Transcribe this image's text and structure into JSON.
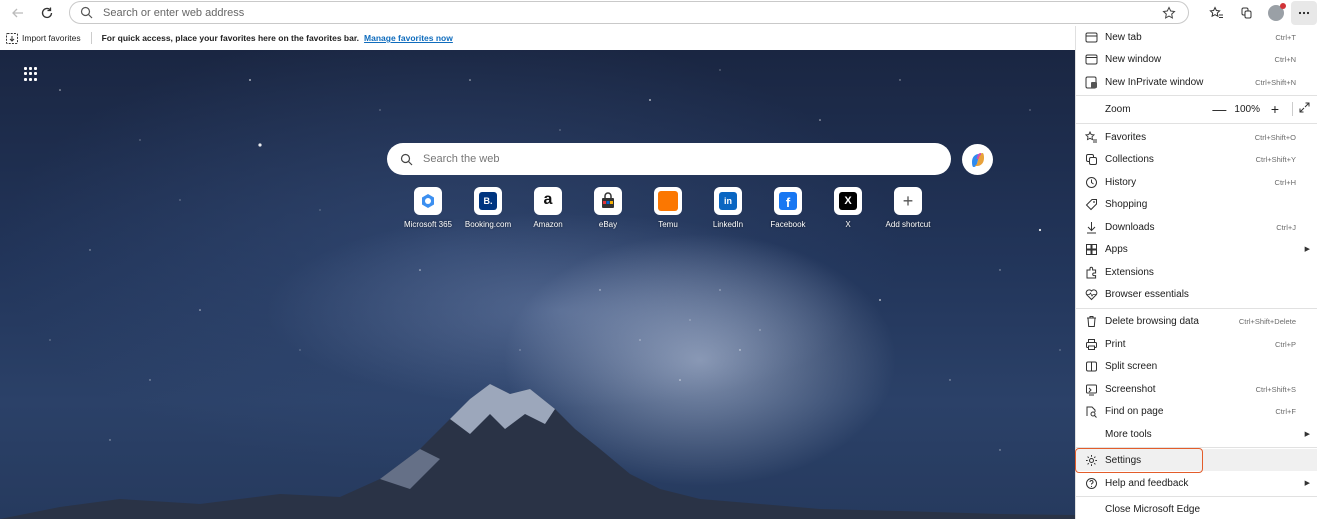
{
  "toolbar": {
    "address_placeholder": "Search or enter web address",
    "icons": [
      "back-icon",
      "refresh-icon",
      "search-icon",
      "star-icon",
      "favorites-icon",
      "collections-icon",
      "profile-icon",
      "more-icon"
    ]
  },
  "favorites_bar": {
    "import_label": "Import favorites",
    "message": "For quick access, place your favorites here on the favorites bar.",
    "link_label": "Manage favorites now"
  },
  "new_tab": {
    "search_placeholder": "Search the web",
    "shortcuts": [
      {
        "label": "Microsoft 365",
        "icon": "microsoft365-icon"
      },
      {
        "label": "Booking.com",
        "icon": "booking-icon"
      },
      {
        "label": "Amazon",
        "icon": "amazon-icon"
      },
      {
        "label": "eBay",
        "icon": "ebay-icon"
      },
      {
        "label": "Temu",
        "icon": "temu-icon"
      },
      {
        "label": "LinkedIn",
        "icon": "linkedin-icon"
      },
      {
        "label": "Facebook",
        "icon": "facebook-icon"
      },
      {
        "label": "X",
        "icon": "x-icon"
      },
      {
        "label": "Add shortcut",
        "icon": "plus-icon"
      }
    ]
  },
  "menu": {
    "items": [
      {
        "label": "New tab",
        "shortcut": "Ctrl+T"
      },
      {
        "label": "New window",
        "shortcut": "Ctrl+N"
      },
      {
        "label": "New InPrivate window",
        "shortcut": "Ctrl+Shift+N"
      },
      {
        "label": "Zoom",
        "shortcut": ""
      },
      {
        "label": "Favorites",
        "shortcut": "Ctrl+Shift+O"
      },
      {
        "label": "Collections",
        "shortcut": "Ctrl+Shift+Y"
      },
      {
        "label": "History",
        "shortcut": "Ctrl+H"
      },
      {
        "label": "Shopping",
        "shortcut": ""
      },
      {
        "label": "Downloads",
        "shortcut": "Ctrl+J"
      },
      {
        "label": "Apps",
        "shortcut": ""
      },
      {
        "label": "Extensions",
        "shortcut": ""
      },
      {
        "label": "Browser essentials",
        "shortcut": ""
      },
      {
        "label": "Delete browsing data",
        "shortcut": "Ctrl+Shift+Delete"
      },
      {
        "label": "Print",
        "shortcut": "Ctrl+P"
      },
      {
        "label": "Split screen",
        "shortcut": ""
      },
      {
        "label": "Screenshot",
        "shortcut": "Ctrl+Shift+S"
      },
      {
        "label": "Find on page",
        "shortcut": "Ctrl+F"
      },
      {
        "label": "More tools",
        "shortcut": ""
      },
      {
        "label": "Settings",
        "shortcut": ""
      },
      {
        "label": "Help and feedback",
        "shortcut": ""
      },
      {
        "label": "Close Microsoft Edge",
        "shortcut": ""
      }
    ],
    "zoom": {
      "minus": "—",
      "value": "100%",
      "plus": "+"
    },
    "highlight_color": "#e35d2b"
  }
}
